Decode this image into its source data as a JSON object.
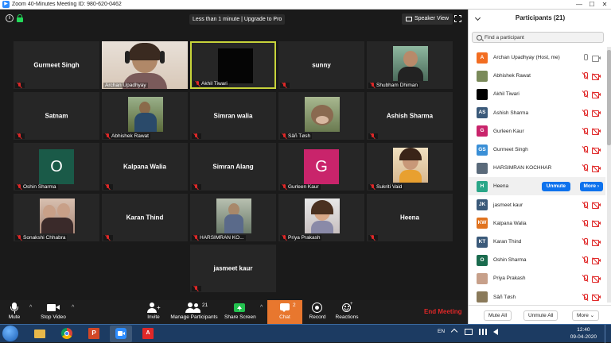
{
  "window": {
    "title": "Zoom 40-Minutes Meeting ID: 980-620-0462",
    "buttons": [
      "—",
      "☐",
      "✕"
    ]
  },
  "meeting": {
    "upgrade_banner": "Less than 1 minute | Upgrade to Pro",
    "speaker_view": "Speaker View",
    "info_glyph": "i"
  },
  "tiles": [
    {
      "name": "Gurmeet Singh",
      "label": ""
    },
    {
      "name": "",
      "label": "Archan Upadhyay"
    },
    {
      "name": "",
      "label": "Akhil Tiwari"
    },
    {
      "name": "sunny",
      "label": ""
    },
    {
      "name": "",
      "label": "Shubham Dhiman"
    },
    {
      "name": "Satnam",
      "label": ""
    },
    {
      "name": "",
      "label": "Abhishek Rawat"
    },
    {
      "name": "Simran walia",
      "label": ""
    },
    {
      "name": "",
      "label": "Sâñ Tøsh"
    },
    {
      "name": "Ashish Sharma",
      "label": ""
    },
    {
      "name": "",
      "label": "Oshin Sharma",
      "avatar_letter": "O"
    },
    {
      "name": "Kalpana Walia",
      "label": ""
    },
    {
      "name": "Simran Alang",
      "label": ""
    },
    {
      "name": "",
      "label": "Gurleen Kaur",
      "avatar_letter": "G"
    },
    {
      "name": "",
      "label": "Sukriti Vaid"
    },
    {
      "name": "",
      "label": "Sonakshi Chhabra"
    },
    {
      "name": "Karan Thind",
      "label": ""
    },
    {
      "name": "",
      "label": "HARSIMRAN KO..."
    },
    {
      "name": "",
      "label": "Priya Prakash"
    },
    {
      "name": "Heena",
      "label": ""
    },
    {
      "name": "jasmeet kaur",
      "label": ""
    }
  ],
  "toolbar": {
    "mute": "Mute",
    "stop_video": "Stop Video",
    "invite": "Invite",
    "manage_participants": "Manage Participants",
    "participant_count": "21",
    "share_screen": "Share Screen",
    "chat": "Chat",
    "chat_badge": "2",
    "record": "Record",
    "reactions": "Reactions",
    "end_meeting": "End Meeting"
  },
  "panel": {
    "title": "Participants (21)",
    "search_placeholder": "Find a participant",
    "participants": [
      {
        "initials": "A",
        "name": "Archan Upadhyay (Host, me)",
        "color": "#f26d21",
        "mic": "on",
        "cam": "on"
      },
      {
        "initials": "",
        "name": "Abhishek Rawat",
        "color": "#7a8a5a",
        "mic": "off",
        "cam": "off"
      },
      {
        "initials": "",
        "name": "Akhil Tiwari",
        "color": "#000000",
        "mic": "off",
        "cam": "off"
      },
      {
        "initials": "AS",
        "name": "Ashish Sharma",
        "color": "#3b5a7a",
        "mic": "off",
        "cam": "off"
      },
      {
        "initials": "G",
        "name": "Gurleen Kaur",
        "color": "#c9246b",
        "mic": "off",
        "cam": "off"
      },
      {
        "initials": "GS",
        "name": "Gurmeet Singh",
        "color": "#3a8fd6",
        "mic": "off",
        "cam": "off"
      },
      {
        "initials": "",
        "name": "HARSIMRAN KOCHHAR",
        "color": "#5a6a7a",
        "mic": "off",
        "cam": "off"
      },
      {
        "initials": "H",
        "name": "Heena",
        "color": "#2aa688",
        "mic": "off",
        "cam": "off"
      },
      {
        "initials": "JK",
        "name": "jasmeet kaur",
        "color": "#3b5a7a",
        "mic": "off",
        "cam": "off"
      },
      {
        "initials": "KW",
        "name": "Kalpana Walia",
        "color": "#e0731f",
        "mic": "off",
        "cam": "off"
      },
      {
        "initials": "KT",
        "name": "Karan Thind",
        "color": "#3b5a7a",
        "mic": "off",
        "cam": "off"
      },
      {
        "initials": "O",
        "name": "Oshin Sharma",
        "color": "#1a6b4e",
        "mic": "off",
        "cam": "off"
      },
      {
        "initials": "",
        "name": "Priya Prakash",
        "color": "#c7a08a",
        "mic": "off",
        "cam": "off"
      },
      {
        "initials": "",
        "name": "Sâñ Tøsh",
        "color": "#8a7a5a",
        "mic": "off",
        "cam": "off"
      }
    ],
    "unmute": "Unmute",
    "more": "More ›",
    "mute_all": "Mute All",
    "unmute_all": "Unmute All",
    "more_footer": "More ⌄"
  },
  "taskbar": {
    "lang": "EN",
    "time": "12:40",
    "date": "09-04-2020"
  }
}
